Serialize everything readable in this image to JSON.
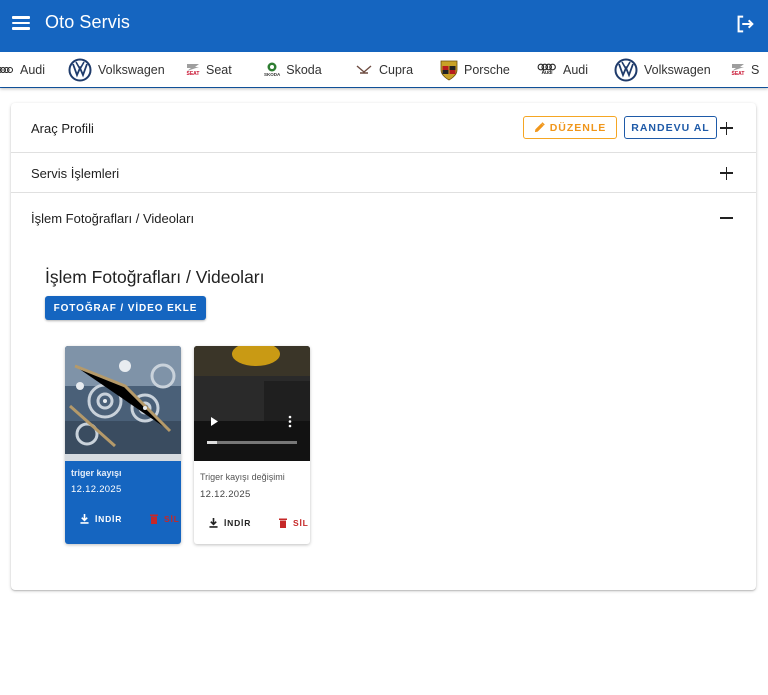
{
  "app": {
    "title": "Oto Servis"
  },
  "brands": [
    {
      "label": "Audi",
      "logo": "audi-logo"
    },
    {
      "label": "Volkswagen",
      "logo": "vw-logo"
    },
    {
      "label": "Seat",
      "logo": "seat-logo",
      "logo_text": "SEAT"
    },
    {
      "label": "Skoda",
      "logo": "skoda-logo",
      "logo_text": "SKODA"
    },
    {
      "label": "Cupra",
      "logo": "cupra-logo"
    },
    {
      "label": "Porsche",
      "logo": "porsche-logo"
    },
    {
      "label": "Audi",
      "logo": "audi-logo",
      "logo_text": "Audi"
    },
    {
      "label": "Volkswagen",
      "logo": "vw-logo"
    },
    {
      "label": "S",
      "logo": "seat-logo",
      "logo_text": "SEAT"
    }
  ],
  "sections": {
    "profile": {
      "label": "Araç Profili",
      "edit_label": "DÜZENLE",
      "appointment_label": "RANDEVU AL"
    },
    "services": {
      "label": "Servis İşlemleri"
    },
    "media": {
      "label": "İşlem Fotoğrafları / Videoları",
      "heading": "İşlem Fotoğrafları / Videoları",
      "add_label": "FOTOĞRAF / VİDEO EKLE",
      "items": [
        {
          "name": "triger kayışı",
          "date": "12.12.2025",
          "type": "photo",
          "download_label": "İNDİR",
          "delete_label": "SİL"
        },
        {
          "name": "Triger kayışı değişimi",
          "date": "12.12.2025",
          "type": "video",
          "download_label": "İNDİR",
          "delete_label": "SİL"
        }
      ]
    }
  },
  "colors": {
    "primary": "#1565c0",
    "edit": "#f0961b",
    "delete": "#c62828"
  }
}
